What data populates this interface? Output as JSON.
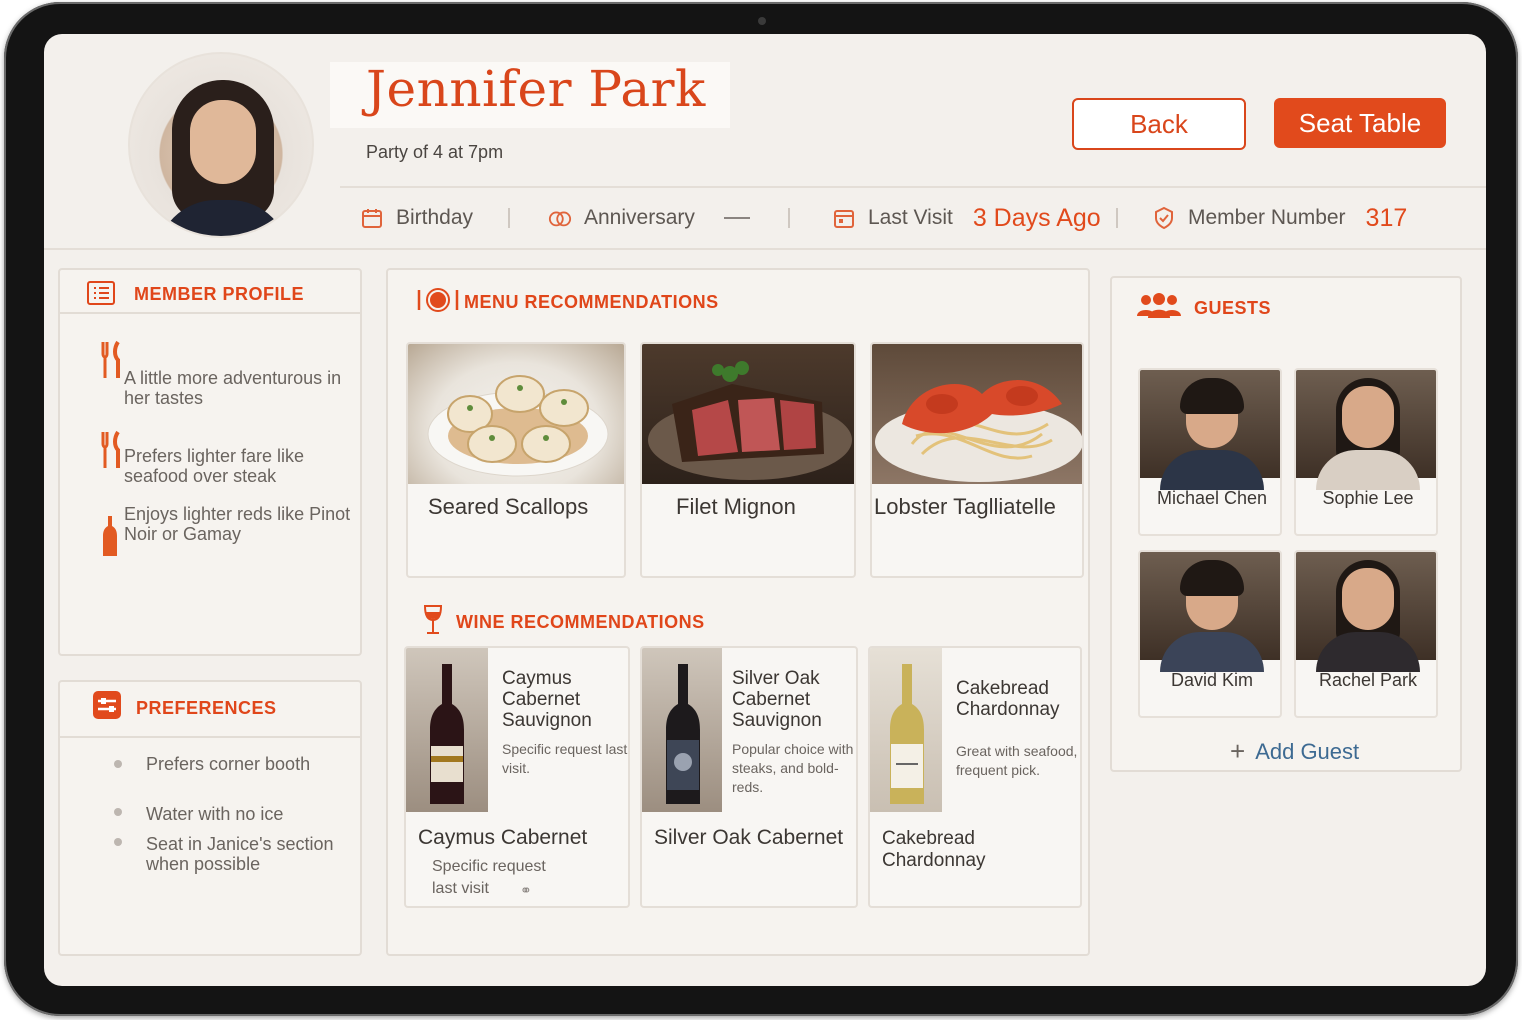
{
  "header": {
    "guest_name": "Jennifer Park",
    "party": "Party of 4 at 7pm",
    "back_label": "Back",
    "seat_label": "Seat Table",
    "birthday_label": "Birthday",
    "anniversary_label": "Anniversary",
    "last_visit_label": "Last Visit",
    "last_visit_value": "3 Days Ago",
    "member_label": "Member Number",
    "member_value": "317"
  },
  "member_profile": {
    "title": "MEMBER PROFILE",
    "notes": [
      "A little more adventurous in her tastes",
      "Prefers lighter fare like seafood over steak",
      "Enjoys lighter reds like Pinot Noir or Gamay"
    ]
  },
  "preferences": {
    "title": "PREFERENCES",
    "items": [
      "Prefers corner booth",
      "Water with no ice",
      "Seat in Janice's section when possible"
    ]
  },
  "menu": {
    "title": "MENU RECOMMENDATIONS",
    "items": [
      "Seared Scallops",
      "Filet Mignon",
      "Lobster Taglliatelle"
    ]
  },
  "wine": {
    "title": "WINE RECOMMENDATIONS",
    "items": [
      {
        "name": "Caymus Cabernet Sauvignon",
        "desc": "Specific request last visit.",
        "footer": "Caymus Cabernet",
        "sub1": "Specific request",
        "sub2": "last visit"
      },
      {
        "name": "Silver Oak Cabernet Sauvignon",
        "desc": "Popular choice with steaks, and bold-reds.",
        "footer": "Silver Oak Cabernet"
      },
      {
        "name": "Cakebread Chardonnay",
        "desc": "Great with seafood, frequent pick.",
        "footer": "Cakebread Chardonnay"
      }
    ]
  },
  "guests": {
    "title": "GUESTS",
    "items": [
      "Michael Chen",
      "Sophie Lee",
      "David Kim",
      "Rachel Park"
    ],
    "add_label": "Add Guest"
  },
  "colors": {
    "accent": "#e14a1c",
    "link": "#3d6a92",
    "background": "#f3f0ec"
  }
}
